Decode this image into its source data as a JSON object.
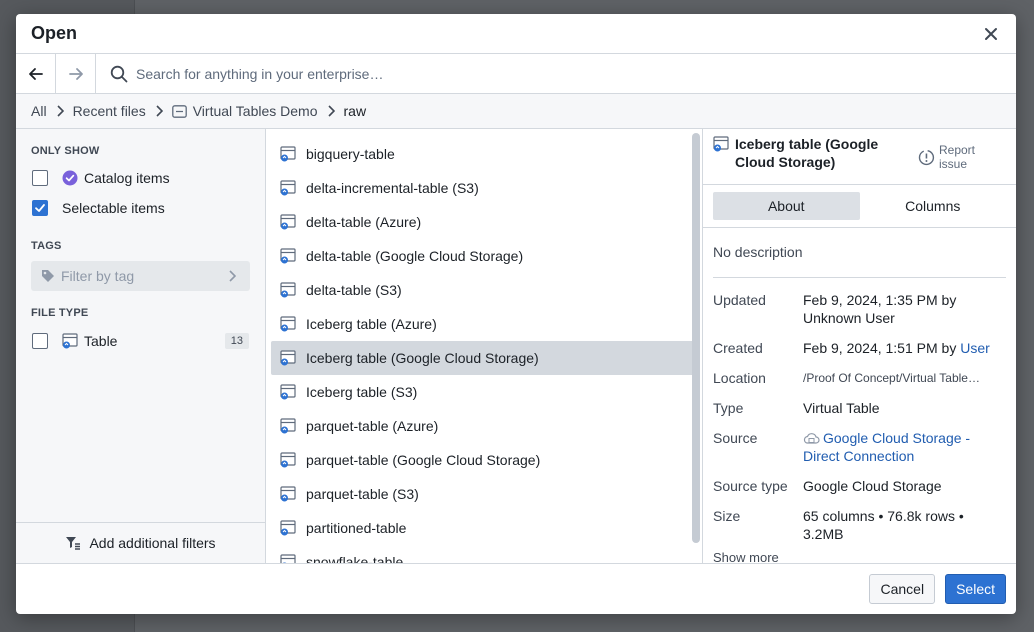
{
  "dialog": {
    "title": "Open"
  },
  "search": {
    "placeholder": "Search for anything in your enterprise…"
  },
  "breadcrumb": [
    "All",
    "Recent files",
    "Virtual Tables Demo",
    "raw"
  ],
  "filters": {
    "only_show_heading": "ONLY SHOW",
    "catalog_label": "Catalog items",
    "selectable_label": "Selectable items",
    "tags_heading": "TAGS",
    "tag_placeholder": "Filter by tag",
    "file_type_heading": "FILE TYPE",
    "table_label": "Table",
    "table_count": "13",
    "add_filters_label": "Add additional filters"
  },
  "files": [
    "bigquery-table",
    "delta-incremental-table (S3)",
    "delta-table (Azure)",
    "delta-table (Google Cloud Storage)",
    "delta-table (S3)",
    "Iceberg table (Azure)",
    "Iceberg table (Google Cloud Storage)",
    "Iceberg table (S3)",
    "parquet-table (Azure)",
    "parquet-table (Google Cloud Storage)",
    "parquet-table (S3)",
    "partitioned-table",
    "snowflake-table"
  ],
  "selected_index": 6,
  "detail": {
    "title": "Iceberg table (Google Cloud Storage)",
    "report_issue": "Report issue",
    "tab_about": "About",
    "tab_columns": "Columns",
    "description": "No description",
    "updated_label": "Updated",
    "updated_value": "Feb 9, 2024, 1:35 PM by Unknown User",
    "created_label": "Created",
    "created_value": "Feb 9, 2024, 1:51 PM by ",
    "created_user": "User",
    "location_label": "Location",
    "location_value": "/Proof Of Concept/Virtual Table…",
    "type_label": "Type",
    "type_value": "Virtual Table",
    "source_label": "Source",
    "source_value": "Google Cloud Storage - Direct Connection",
    "source_type_label": "Source type",
    "source_type_value": "Google Cloud Storage",
    "size_label": "Size",
    "size_value": "65 columns • 76.8k rows • 3.2MB",
    "show_more": "Show more"
  },
  "footer": {
    "cancel": "Cancel",
    "select": "Select"
  },
  "colors": {
    "accent": "#2d72d2",
    "catalog_badge": "#7961db",
    "table_icon": "#2d72d2"
  }
}
